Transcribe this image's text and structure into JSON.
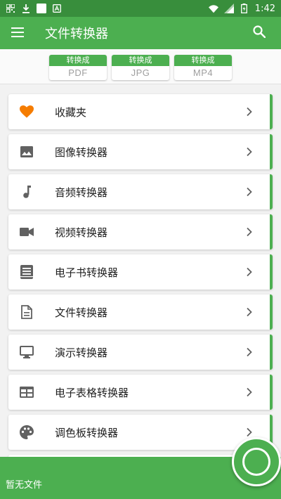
{
  "status_bar": {
    "time": "1:42",
    "left_icons": [
      "qr-code-icon",
      "download-icon",
      "square-icon",
      "a-badge-icon"
    ],
    "right_icons": [
      "wifi-icon",
      "signal-icon",
      "battery-icon"
    ]
  },
  "app_bar": {
    "title": "文件转换器",
    "menu_icon": "menu-icon",
    "search_icon": "search-icon"
  },
  "format_tabs": [
    {
      "top": "转换成",
      "name": "PDF"
    },
    {
      "top": "转换成",
      "name": "JPG"
    },
    {
      "top": "转换成",
      "name": "MP4"
    }
  ],
  "items": [
    {
      "label": "收藏夹",
      "icon": "heart-icon"
    },
    {
      "label": "图像转换器",
      "icon": "image-icon"
    },
    {
      "label": "音频转换器",
      "icon": "music-note-icon"
    },
    {
      "label": "视频转换器",
      "icon": "video-camera-icon"
    },
    {
      "label": "电子书转换器",
      "icon": "book-icon"
    },
    {
      "label": "文件转换器",
      "icon": "document-icon"
    },
    {
      "label": "演示转换器",
      "icon": "monitor-icon"
    },
    {
      "label": "电子表格转换器",
      "icon": "table-icon"
    },
    {
      "label": "调色板转换器",
      "icon": "palette-icon"
    }
  ],
  "bottom_bar": {
    "empty_text": "暂无文件"
  },
  "colors": {
    "primary": "#4caf50",
    "status_bar": "#388e3c",
    "favorite": "#f57c00",
    "icon_gray": "#616161"
  }
}
